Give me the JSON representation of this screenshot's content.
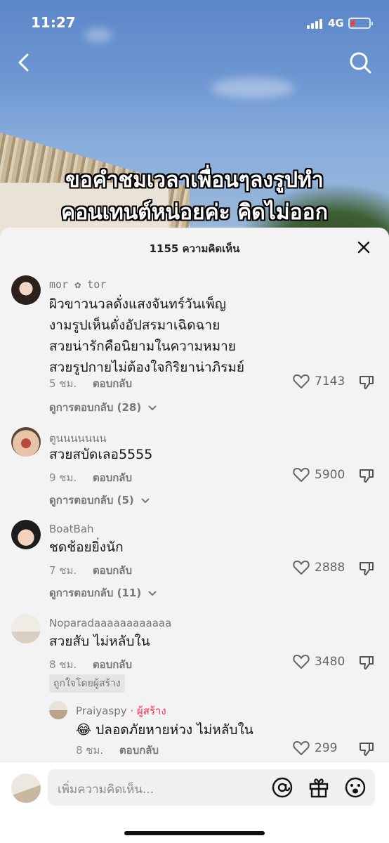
{
  "status_bar": {
    "time": "11:27",
    "network": "4G",
    "battery_level": 0.1
  },
  "video": {
    "caption_line1": "ขอคำชมเวลาเพื่อนๆลงรูปทำ",
    "caption_line2": "คอนเทนต์หน่อยค่ะ คิดไม่ออก"
  },
  "sheet": {
    "title": "1155 ความคิดเห็น"
  },
  "comments": [
    {
      "username": "mor ✿ tor",
      "text_lines": [
        "ผิวขาวนวลดั่งแสงจันทร์วันเพ็ญ",
        "งามรูปเห็นดั่งอัปสรมาเฉิดฉาย",
        "สวยน่ารักคือนิยามในความหมาย",
        "สวยรูปกายไม่ต้องใจกิริยาน่าภิรมย์"
      ],
      "time": "5 ชม.",
      "reply_label": "ตอบกลับ",
      "likes": "7143",
      "view_replies": "ดูการตอบกลับ (28)"
    },
    {
      "username": "ตูนนนนนนน",
      "text_lines": [
        "สวยสบัดเลอ5555"
      ],
      "time": "9 ชม.",
      "reply_label": "ตอบกลับ",
      "likes": "5900",
      "view_replies": "ดูการตอบกลับ (5)"
    },
    {
      "username": "BoatBah",
      "text_lines": [
        "ชดช้อยยิ่งนัก"
      ],
      "time": "7 ชม.",
      "reply_label": "ตอบกลับ",
      "likes": "2888",
      "view_replies": "ดูการตอบกลับ (11)"
    },
    {
      "username": "Noparadaaaaaaaaaaaa",
      "text_lines": [
        "สวยสับ ไม่หลับใน"
      ],
      "time": "8 ชม.",
      "reply_label": "ตอบกลับ",
      "likes": "3480",
      "badge": "ถูกใจโดยผู้สร้าง"
    }
  ],
  "reply": {
    "username": "Praiyaspy",
    "creator_tag": "· ผู้สร้าง",
    "text": "😂 ปลอดภัยหายห่วง ไม่หลับใน",
    "time": "8 ชม.",
    "reply_label": "ตอบกลับ",
    "likes": "299"
  },
  "input": {
    "placeholder": "เพิ่มความคิดเห็น..."
  },
  "icons": {
    "back": "chevron-left-icon",
    "search": "search-icon",
    "close": "close-icon",
    "like": "heart-outline-icon",
    "dislike": "thumbs-down-icon",
    "mention": "at-sign-icon",
    "gift": "gift-icon",
    "emoji": "emoji-icon"
  },
  "colors": {
    "accent": "#fe2c55",
    "sheet_bg": "#f3f3f3"
  }
}
